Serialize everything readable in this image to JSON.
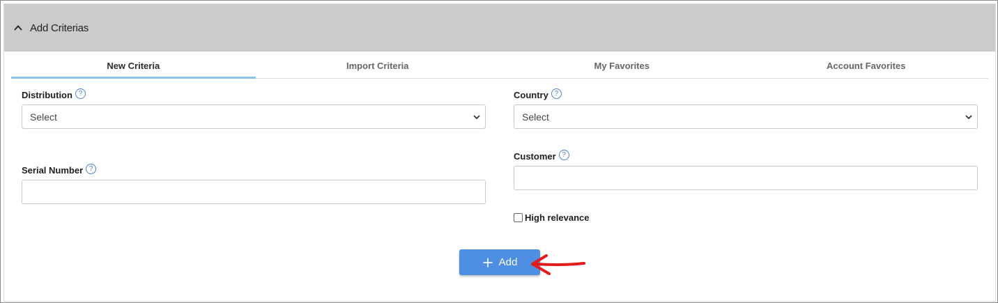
{
  "header": {
    "title": "Add Criterias",
    "icon": "chevron-up-icon"
  },
  "tabs": [
    {
      "label": "New Criteria",
      "active": true
    },
    {
      "label": "Import Criteria",
      "active": false
    },
    {
      "label": "My Favorites",
      "active": false
    },
    {
      "label": "Account Favorites",
      "active": false
    }
  ],
  "form": {
    "distribution": {
      "label": "Distribution",
      "value": "Select"
    },
    "country": {
      "label": "Country",
      "value": "Select"
    },
    "customer": {
      "label": "Customer",
      "value": ""
    },
    "serial_number": {
      "label": "Serial Number",
      "value": ""
    },
    "high_relevance": {
      "label": "High relevance",
      "checked": false
    },
    "help_glyph": "?"
  },
  "add_button": {
    "label": "Add",
    "icon": "plus-icon"
  },
  "colors": {
    "header_bg": "#cbcbcb",
    "tab_underline": "#8cc3ea",
    "button_bg": "#4e8fe3",
    "annotation": "#e31b1b",
    "help_icon": "#4a7fc8"
  }
}
